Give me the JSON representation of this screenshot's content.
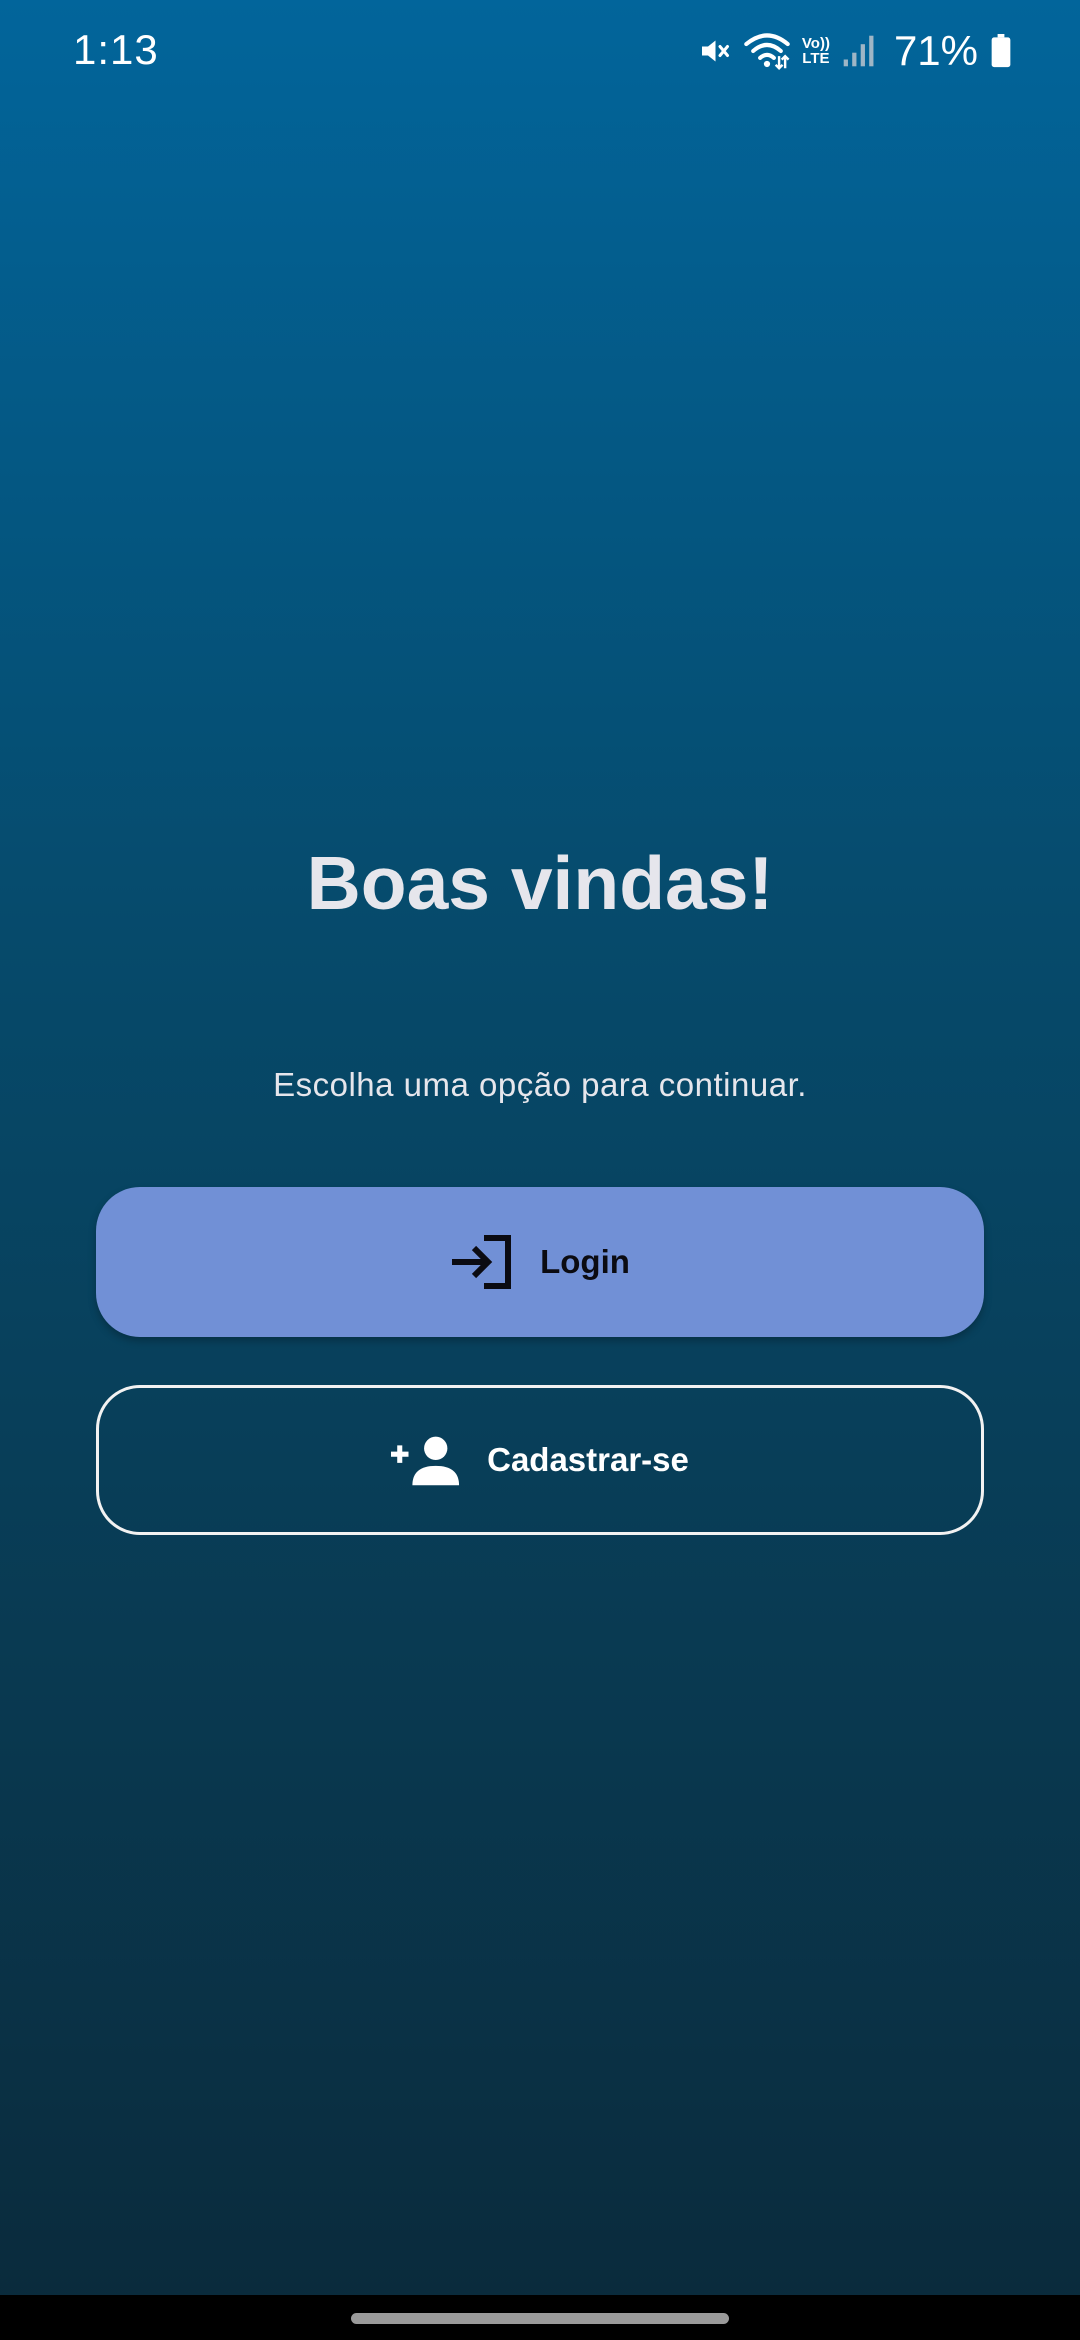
{
  "status_bar": {
    "time": "1:13",
    "battery_percent": "71%",
    "network_label_top": "Vo))",
    "network_label_bottom": "LTE",
    "icons": [
      "mute-icon",
      "wifi-icon",
      "volte-icon",
      "signal-icon",
      "battery-icon"
    ]
  },
  "welcome": {
    "title": "Boas vindas!",
    "subtitle": "Escolha uma opção para continuar."
  },
  "buttons": {
    "login": {
      "label": "Login",
      "icon": "login-icon"
    },
    "register": {
      "label": "Cadastrar-se",
      "icon": "person-add-icon"
    }
  },
  "colors": {
    "background_top": "#02659b",
    "background_bottom": "#0a2a3b",
    "login_button": "#7190d6",
    "register_border": "#f2f2f2",
    "text": "#e6e6ec"
  }
}
